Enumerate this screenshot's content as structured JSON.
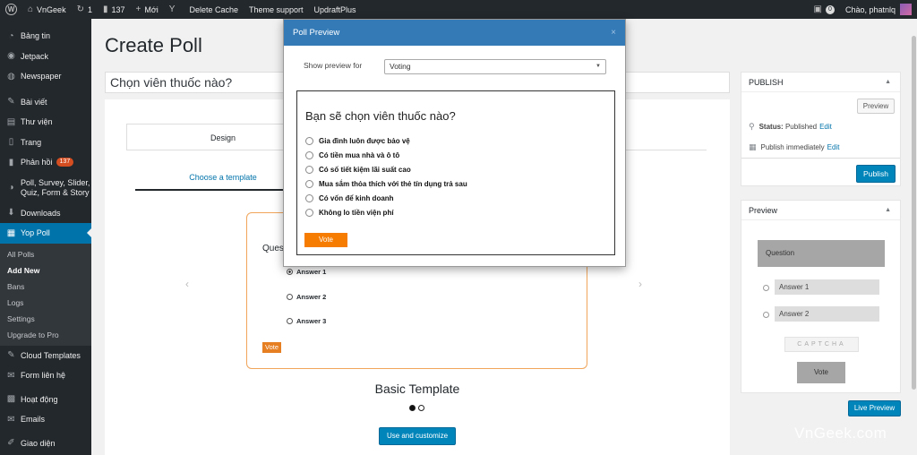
{
  "adminbar": {
    "site_name": "VnGeek",
    "updates_count": "1",
    "comments_count": "137",
    "new_label": "Mới",
    "yoast_label": "Y",
    "delete_cache": "Delete Cache",
    "theme_support": "Theme support",
    "updraftplus": "UpdraftPlus",
    "notif_count": "0",
    "greeting": "Chào, phatnlq"
  },
  "sidebar": {
    "items": [
      {
        "label": "Bảng tin",
        "icon": "dashboard-icon"
      },
      {
        "label": "Jetpack",
        "icon": "jetpack-icon"
      },
      {
        "label": "Newspaper",
        "icon": "newspaper-icon"
      },
      {
        "label": "Bài viết",
        "icon": "pin-icon"
      },
      {
        "label": "Thư viện",
        "icon": "media-icon"
      },
      {
        "label": "Trang",
        "icon": "page-icon"
      },
      {
        "label": "Phản hồi",
        "icon": "comments-icon",
        "badge": "137"
      },
      {
        "label": "Poll, Survey, Slider, Quiz, Form & Story",
        "icon": "poll-icon"
      },
      {
        "label": "Downloads",
        "icon": "download-icon"
      },
      {
        "label": "Yop Poll",
        "icon": "yop-poll-icon"
      }
    ],
    "submenu": [
      "All Polls",
      "Add New",
      "Bans",
      "Logs",
      "Settings",
      "Upgrade to Pro"
    ],
    "items_after": [
      {
        "label": "Cloud Templates",
        "icon": "pin-icon"
      },
      {
        "label": "Form liên hệ",
        "icon": "mail-icon"
      },
      {
        "label": "Hoạt động",
        "icon": "activity-icon"
      },
      {
        "label": "Emails",
        "icon": "email-icon"
      },
      {
        "label": "Giao diện",
        "icon": "appearance-icon"
      }
    ]
  },
  "main": {
    "page_title": "Create Poll",
    "title_value": "Chọn viên thuốc nào?",
    "tab_design": "Design",
    "choose_template": "Choose a template",
    "template": {
      "question": "Ques",
      "answers": [
        "Answer 1",
        "Answer 2",
        "Answer 3"
      ],
      "vote": "Vote",
      "name": "Basic Template"
    },
    "use_button": "Use and customize"
  },
  "publish_box": {
    "title": "PUBLISH",
    "preview_button": "Preview",
    "status_label": "Status:",
    "status_value": "Published",
    "edit": "Edit",
    "publish_immediately": "Publish immediately",
    "publish_button": "Publish"
  },
  "preview_box": {
    "title": "Preview",
    "question": "Question",
    "answers": [
      "Answer 1",
      "Answer 2"
    ],
    "captcha": "CAPTCHA",
    "vote": "Vote",
    "live_preview": "Live Preview"
  },
  "modal": {
    "title": "Poll Preview",
    "close": "×",
    "show_preview_for_label": "Show preview for",
    "select_value": "Voting",
    "poll_question": "Bạn sẽ chọn viên thuốc nào?",
    "answers": [
      "Gia đình luôn được bảo vệ",
      "Có tiền mua nhà và ô tô",
      "Có số tiết kiệm lãi suất cao",
      "Mua sắm thỏa thích với thẻ tín dụng trả sau",
      "Có vốn để kinh doanh",
      "Không lo tiền viện phí"
    ],
    "vote": "Vote"
  },
  "watermark": "VnGeek.com",
  "colors": {
    "admin_dark": "#23282d",
    "accent_blue": "#0073aa",
    "button_blue": "#0085ba",
    "modal_header": "#337ab7",
    "vote_orange": "#f57c00"
  }
}
